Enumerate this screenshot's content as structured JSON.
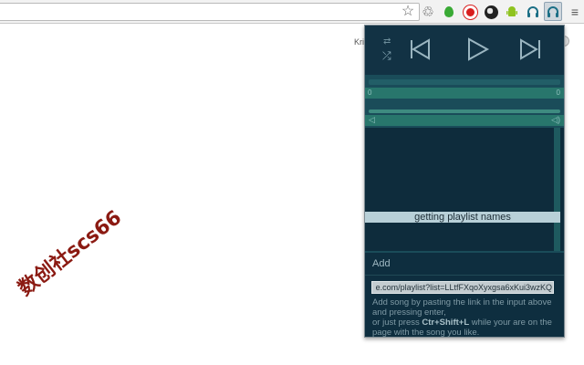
{
  "page": {
    "partial_text": "Kri"
  },
  "toolbar": {
    "icons": [
      "star-icon",
      "recycle-icon",
      "leaf-icon",
      "record-icon",
      "globe-icon",
      "android-icon",
      "headphones-icon",
      "headphones-active-icon",
      "menu-icon"
    ],
    "glyphs": {
      "star": "☆",
      "recycle": "♲",
      "android": "⚉",
      "headphones": "∩",
      "menu": "≡"
    }
  },
  "player": {
    "controls": {
      "repeat_glyph": "⇄",
      "shuffle_glyph": "⤮"
    },
    "time_elapsed": "0",
    "time_total": "0",
    "mute_glyph": "◁",
    "volume_glyph": "◁)",
    "status": "getting playlist names",
    "colors": {
      "background": "#0e2e3f",
      "accent": "#28766c"
    }
  },
  "add": {
    "label": "Add",
    "url_value": "e.com/playlist?list=LLtfFXqoXyxgsa6xKui3wzKQ",
    "help_line1": "Add song by pasting the link in the input above and pressing enter,",
    "help_prefix": "or just press ",
    "shortcut": "Ctr+Shift+L",
    "help_suffix": " while your are on the page with the song you like."
  },
  "watermark": {
    "text": "数创社scs66"
  }
}
